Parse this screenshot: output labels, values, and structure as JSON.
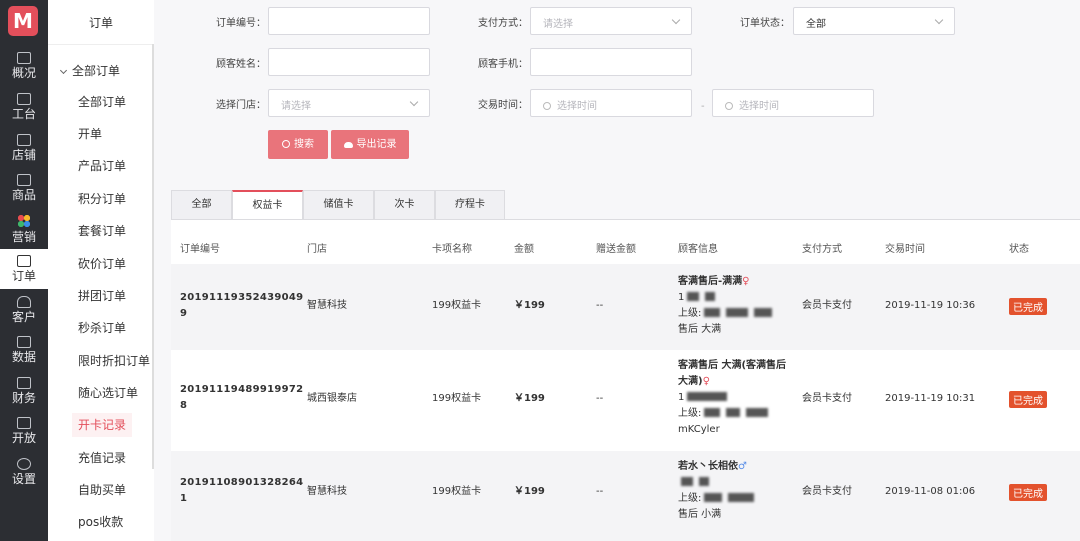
{
  "rail": {
    "logo": "M",
    "items": [
      {
        "label": "概况"
      },
      {
        "label": "工台"
      },
      {
        "label": "店铺"
      },
      {
        "label": "商品"
      },
      {
        "label": "营销"
      },
      {
        "label": "订单"
      },
      {
        "label": "客户"
      },
      {
        "label": "数据"
      },
      {
        "label": "财务"
      },
      {
        "label": "开放"
      },
      {
        "label": "设置"
      }
    ]
  },
  "subnav": {
    "title": "订单",
    "group": "全部订单",
    "items": [
      "全部订单",
      "开单",
      "产品订单",
      "积分订单",
      "套餐订单",
      "砍价订单",
      "拼团订单",
      "秒杀订单",
      "限时折扣订单",
      "随心选订单",
      "开卡记录",
      "充值记录",
      "自助买单",
      "pos收款"
    ],
    "active_index": 10
  },
  "filters": {
    "order_no_label": "订单编号：",
    "pay_method_label": "支付方式：",
    "pay_method_placeholder": "请选择",
    "status_label": "订单状态：",
    "status_value": "全部",
    "customer_name_label": "顾客姓名：",
    "customer_phone_label": "顾客手机：",
    "store_label": "选择门店：",
    "store_placeholder": "请选择",
    "time_label": "交易时间：",
    "time_start_placeholder": "选择时间",
    "time_end_placeholder": "选择时间",
    "range_sep": "-",
    "search_btn": "搜索",
    "export_btn": "导出记录"
  },
  "tabs": [
    "全部",
    "权益卡",
    "储值卡",
    "次卡",
    "疗程卡"
  ],
  "active_tab": 1,
  "table": {
    "headers": [
      "订单编号",
      "门店",
      "卡项名称",
      "金额",
      "赠送金额",
      "顾客信息",
      "支付方式",
      "交易时间",
      "状态"
    ],
    "rows": [
      {
        "order_line1": "20191119352439049",
        "order_line2": "9",
        "store": "智慧科技",
        "card": "199权益卡",
        "amount": "￥199",
        "gift": "--",
        "cust_line1": "客满售后-满满",
        "cust_gender": "♀",
        "cust_line2": "1",
        "cust_line3": "上级:",
        "cust_line4": "售后 大满",
        "pay": "会员卡支付",
        "time": "2019-11-19 10:36",
        "status": "已完成"
      },
      {
        "order_line1": "20191119489919972",
        "order_line2": "8",
        "store": "城西银泰店",
        "card": "199权益卡",
        "amount": "￥199",
        "gift": "--",
        "cust_line1": "客满售后 大满(客满售后",
        "cust_line1b": "大满)",
        "cust_gender": "♀",
        "cust_line2": "1",
        "cust_line3": "上级:",
        "cust_line4": "mKCyler",
        "pay": "会员卡支付",
        "time": "2019-11-19 10:31",
        "status": "已完成"
      },
      {
        "order_line1": "20191108901328264",
        "order_line2": "1",
        "store": "智慧科技",
        "card": "199权益卡",
        "amount": "￥199",
        "gift": "--",
        "cust_line1": "若水丶长相依",
        "cust_gender": "♂",
        "cust_line2": "",
        "cust_line3": "上级:",
        "cust_line4": "售后 小满",
        "pay": "会员卡支付",
        "time": "2019-11-08 01:06",
        "status": "已完成"
      }
    ]
  },
  "colors": {
    "accent": "#e34f5b",
    "button": "#e9747b",
    "status": "#e3522d",
    "rail": "#2c2e33"
  }
}
